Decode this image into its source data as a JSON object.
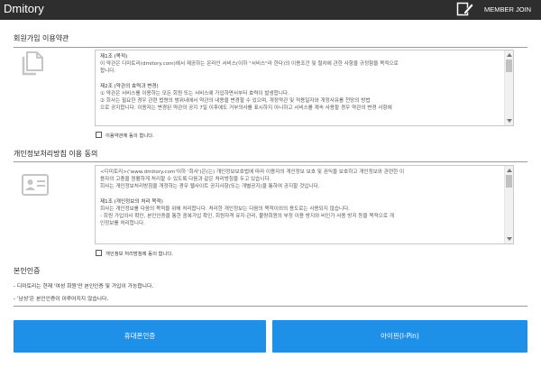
{
  "header": {
    "brand": "Dmitory",
    "join_icon": "pen-signup-icon",
    "join_label": "MEMBER JOIN",
    "bg_color": "#2e2e2e"
  },
  "terms": {
    "title": "회원가입 이용약관",
    "icon": "copy-documents-icon",
    "lines": [
      {
        "text": "제1조 (목적)",
        "style": "h"
      },
      {
        "text": "이 약관은 디미토리(dmitory.com)에서 제공하는 온라인 서비스(이하 \"서비스\"라 한다)의 이용조건 및 절차에 관한 사항을 규정함을 목적으로",
        "style": ""
      },
      {
        "text": "합니다.",
        "style": ""
      },
      {
        "text": "",
        "style": "gap"
      },
      {
        "text": "제2조 (약관의 효력과 변경)",
        "style": "h"
      },
      {
        "text": "① 약관은 서비스를 이용하는 모든 회원 또는 서비스에 가입하면서부터 효력이 발생합니다.",
        "style": ""
      },
      {
        "text": "② 회사는 필요한 경우 관련 법령의 범위내에서 약관의 내용을 변경할 수 있으며, 개정약관 및 적용일자와 개정사유를 천망의 방법",
        "style": ""
      },
      {
        "text": "으로 공지합니다. 이용자는 변경된 약관의 공지 7일 이후에도 거부의사를 표시하지 아니하고 서비스를 계속 사용할 경우 약관의 변경 사항에",
        "style": ""
      }
    ],
    "agree_label": "이용약관에 동의 합니다."
  },
  "privacy": {
    "title": "개인정보처리방침 이용 동의",
    "icon": "id-card-icon",
    "lines": [
      {
        "text": "<디미토리>('www.dmitory.com'이하 '회사')은(는) 개인정보보호법에 따라 이용자의 개인정보 보호 및 권익을 보호하고 개인정보와 관련한 이",
        "style": ""
      },
      {
        "text": "용자의 고충을 원활하게 처리할 수 있도록 다음과 같은 처리방침을 두고 있습니다.",
        "style": ""
      },
      {
        "text": "회사는 개인정보처리방침을 개정하는 경우 웹사이트 공지사항(또는 개별공지)을 통하여 공지할 것입니다.",
        "style": ""
      },
      {
        "text": "",
        "style": "gap"
      },
      {
        "text": "제1조 (개인정보의 처리 목적)",
        "style": "h"
      },
      {
        "text": "회사는 개인정보를 다음의 목적을 위해 처리합니다. 처리한 개인정보는 다음의 목적이외의 용도로는 사용되지 않습니다.",
        "style": ""
      },
      {
        "text": "- 회원 가입의사 확인, 본인인증을 통한 중복가입 확인, 회원자격 유지·관리, 불량회원의 부정 이용 방지와 비인가 사용 방지 등을 목적으로 개",
        "style": ""
      },
      {
        "text": "인정보를 처리합니다.",
        "style": ""
      }
    ],
    "agree_label": "개인정보 처리방침에 동의 합니다."
  },
  "certification": {
    "title": "본인인증",
    "notes": [
      "- 디미토리는 현재 '여성 회원'만 본인인증 및 가입이 가능합니다.",
      "- '남성'은 본인인증이 이루어지지 않습니다."
    ]
  },
  "buttons": {
    "phone_label": "휴대폰인증",
    "ipin_label": "아이핀(I-Pin)",
    "color": "#1e90e8"
  }
}
